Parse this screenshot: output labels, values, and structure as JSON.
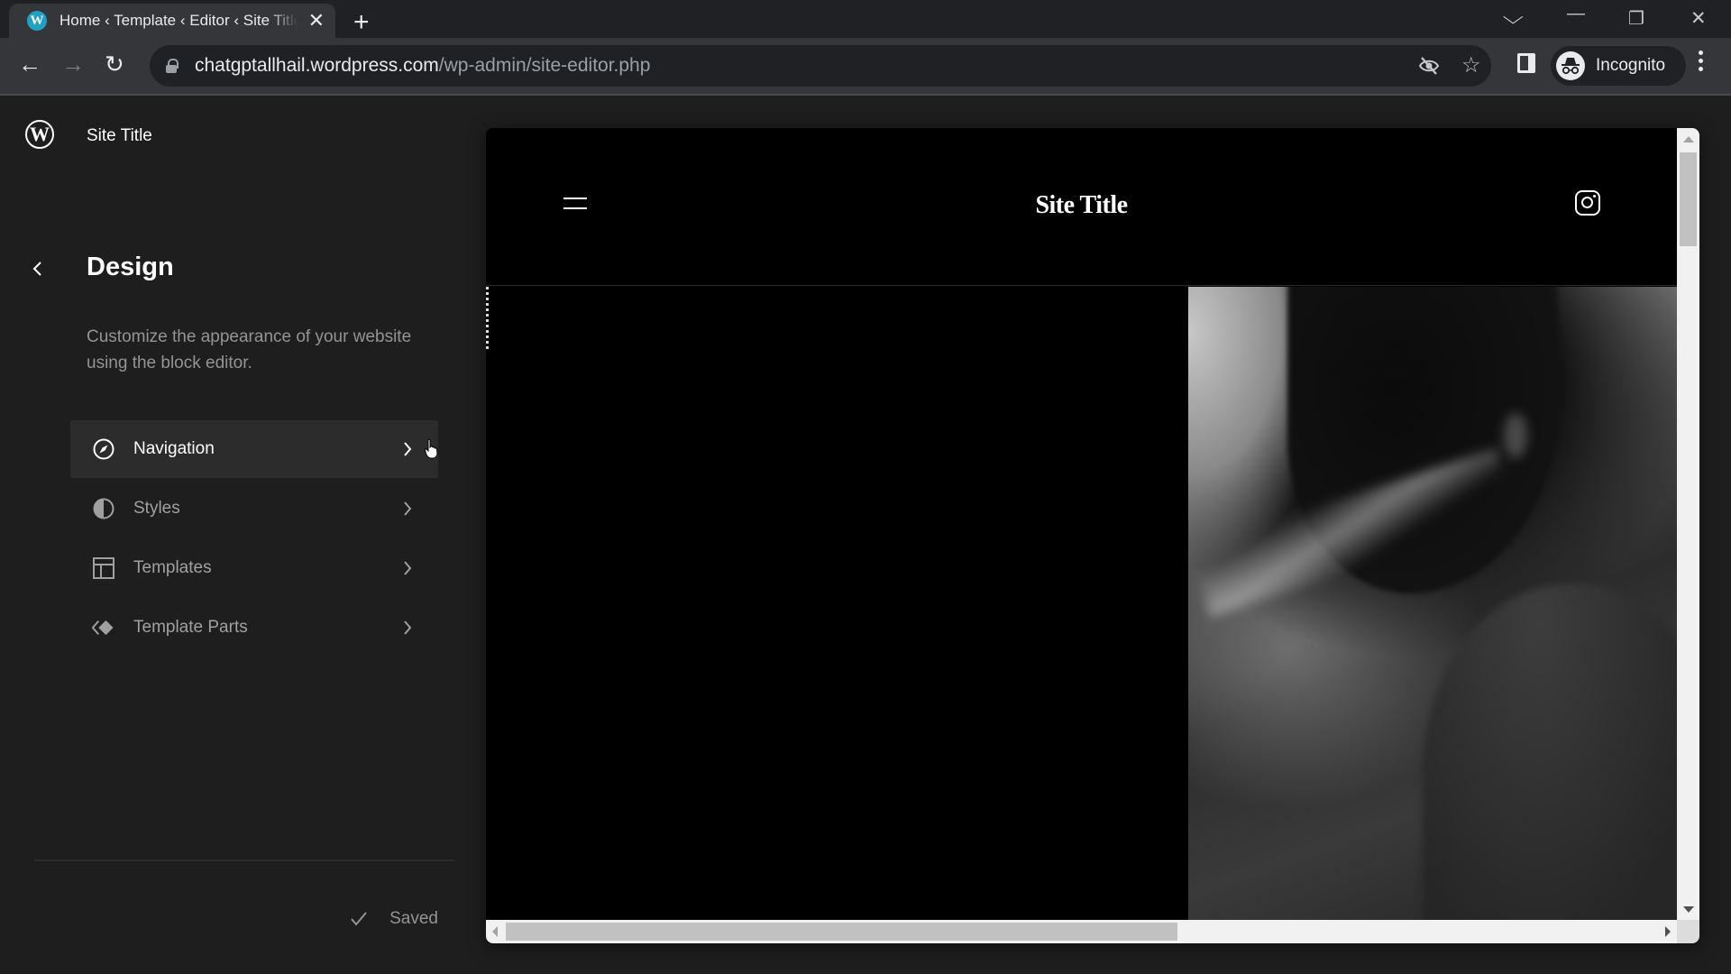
{
  "browser": {
    "tab": {
      "favicon": "wordpress-icon",
      "title": "Home ‹ Template ‹ Editor ‹ Site Title",
      "close": "✕"
    },
    "new_tab": "+",
    "window_controls": {
      "tab_search": "⌵",
      "minimize": "—",
      "restore": "❐",
      "close": "✕"
    },
    "nav": {
      "back": "←",
      "forward": "→",
      "reload": "↻"
    },
    "address": {
      "host": "chatgptallhail.wordpress.com",
      "path": "/wp-admin/site-editor.php"
    },
    "omnibox_icons": [
      "eye-slash-icon",
      "star-icon"
    ],
    "bookmark_star": "☆",
    "tracking_icon": "⊘",
    "profile": {
      "label": "Incognito"
    }
  },
  "sidebar": {
    "logo": "W",
    "site_title": "Site Title",
    "section_title": "Design",
    "description": "Customize the appearance of your website using the block editor.",
    "menu": [
      {
        "label": "Navigation",
        "icon": "compass-icon",
        "active": true
      },
      {
        "label": "Styles",
        "icon": "half-circle-icon",
        "active": false
      },
      {
        "label": "Templates",
        "icon": "layout-icon",
        "active": false
      },
      {
        "label": "Template Parts",
        "icon": "diamond-icon",
        "active": false
      }
    ],
    "status": "Saved"
  },
  "preview": {
    "site_title": "Site Title",
    "social": "instagram-icon",
    "menu": "hamburger-icon"
  }
}
